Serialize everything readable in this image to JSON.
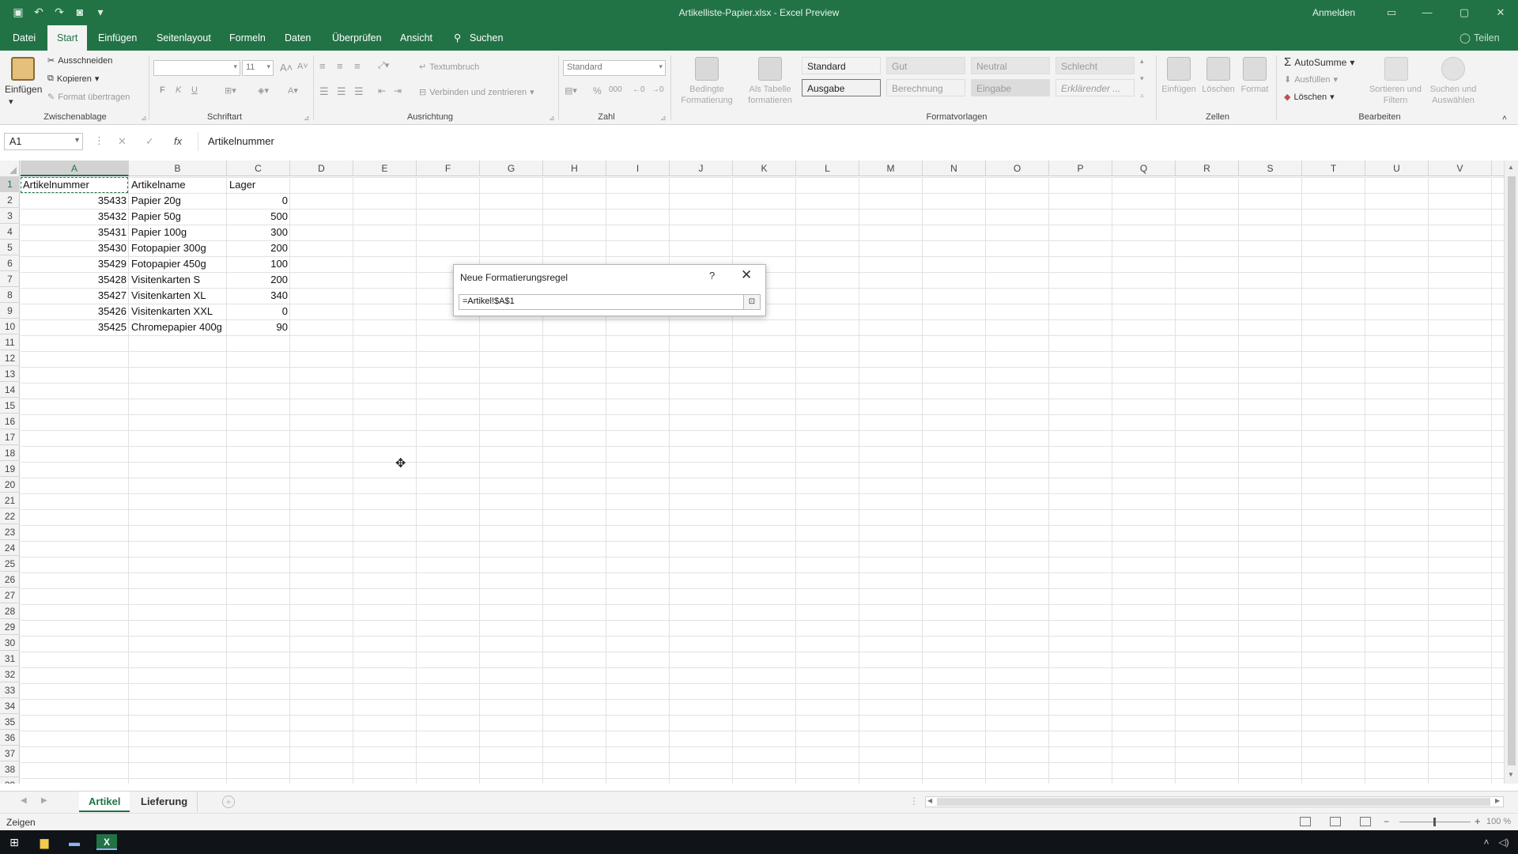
{
  "window": {
    "title": "Artikelliste-Papier.xlsx - Excel Preview",
    "sign_in": "Anmelden"
  },
  "tabs": [
    {
      "label": "Datei"
    },
    {
      "label": "Start"
    },
    {
      "label": "Einfügen"
    },
    {
      "label": "Seitenlayout"
    },
    {
      "label": "Formeln"
    },
    {
      "label": "Daten"
    },
    {
      "label": "Überprüfen"
    },
    {
      "label": "Ansicht"
    },
    {
      "label": "Suchen"
    },
    {
      "label": "Teilen"
    }
  ],
  "ribbon": {
    "clipboard": {
      "paste": "Einfügen",
      "cut": "Ausschneiden",
      "copy": "Kopieren",
      "format_painter": "Format übertragen",
      "group": "Zwischenablage"
    },
    "font": {
      "font_name": "",
      "font_size": "11",
      "bold": "F",
      "italic": "K",
      "underline": "U",
      "group": "Schriftart"
    },
    "alignment": {
      "wrap_text": "Textumbruch",
      "merge_center": "Verbinden und zentrieren",
      "group": "Ausrichtung"
    },
    "number": {
      "format": "Standard",
      "group": "Zahl"
    },
    "styles": {
      "conditional": "Bedingte Formatierung",
      "as_table": "Als Tabelle formatieren",
      "cells": [
        {
          "label": "Standard",
          "bg": "#ffffff",
          "color": "#222222"
        },
        {
          "label": "Gut",
          "bg": "#e6e6e6",
          "color": "#9a9a9a"
        },
        {
          "label": "Neutral",
          "bg": "#e6e6e6",
          "color": "#9a9a9a"
        },
        {
          "label": "Schlecht",
          "bg": "#e6e6e6",
          "color": "#9a9a9a"
        },
        {
          "label": "Ausgabe",
          "bg": "#f2f2f2",
          "color": "#333333"
        },
        {
          "label": "Berechnung",
          "bg": "#f2f2f2",
          "color": "#9a9a9a"
        },
        {
          "label": "Eingabe",
          "bg": "#dcdcdc",
          "color": "#9a9a9a"
        },
        {
          "label": "Erklärender ...",
          "bg": "#ffffff",
          "color": "#9a9a9a"
        }
      ],
      "group": "Formatvorlagen"
    },
    "cells_group": {
      "insert": "Einfügen",
      "delete": "Löschen",
      "format": "Format",
      "group": "Zellen"
    },
    "editing": {
      "autosum": "AutoSumme",
      "fill": "Ausfüllen",
      "clear": "Löschen",
      "sort": "Sortieren und Filtern",
      "find": "Suchen und Auswählen",
      "group": "Bearbeiten"
    }
  },
  "formula_bar": {
    "name_box": "A1",
    "cancel": "✕",
    "enter": "✓",
    "fx": "fx",
    "content": "Artikelnummer"
  },
  "grid": {
    "columns": [
      "A",
      "B",
      "C",
      "D",
      "E",
      "F",
      "G",
      "H",
      "I",
      "J",
      "K",
      "L",
      "M",
      "N",
      "O",
      "P",
      "Q",
      "R",
      "S",
      "T",
      "U",
      "V"
    ],
    "selected_column": "A",
    "selected_row": 1,
    "row_count": 39,
    "headers": [
      "Artikelnummer",
      "Artikelname",
      "Lager"
    ],
    "rows": [
      {
        "nr": "35433",
        "name": "Papier 20g",
        "lager": "0"
      },
      {
        "nr": "35432",
        "name": "Papier 50g",
        "lager": "500"
      },
      {
        "nr": "35431",
        "name": "Papier 100g",
        "lager": "300"
      },
      {
        "nr": "35430",
        "name": "Fotopapier 300g",
        "lager": "200"
      },
      {
        "nr": "35429",
        "name": "Fotopapier 450g",
        "lager": "100"
      },
      {
        "nr": "35428",
        "name": "Visitenkarten S",
        "lager": "200"
      },
      {
        "nr": "35427",
        "name": "Visitenkarten XL",
        "lager": "340"
      },
      {
        "nr": "35426",
        "name": "Visitenkarten XXL",
        "lager": "0"
      },
      {
        "nr": "35425",
        "name": "Chromepapier 400g",
        "lager": "90"
      }
    ]
  },
  "dialog": {
    "title": "Neue Formatierungsregel",
    "help": "?",
    "close": "✕",
    "input_value": "=Artikel!$A$1"
  },
  "sheets": [
    {
      "label": "Artikel",
      "active": true
    },
    {
      "label": "Lieferung",
      "active": false
    }
  ],
  "status": {
    "mode": "Zeigen",
    "zoom": "100 %"
  },
  "colors": {
    "accent": "#217346"
  },
  "icons": {
    "start": "windows-start-icon",
    "explorer": "file-explorer-icon",
    "excel": "excel-icon"
  }
}
